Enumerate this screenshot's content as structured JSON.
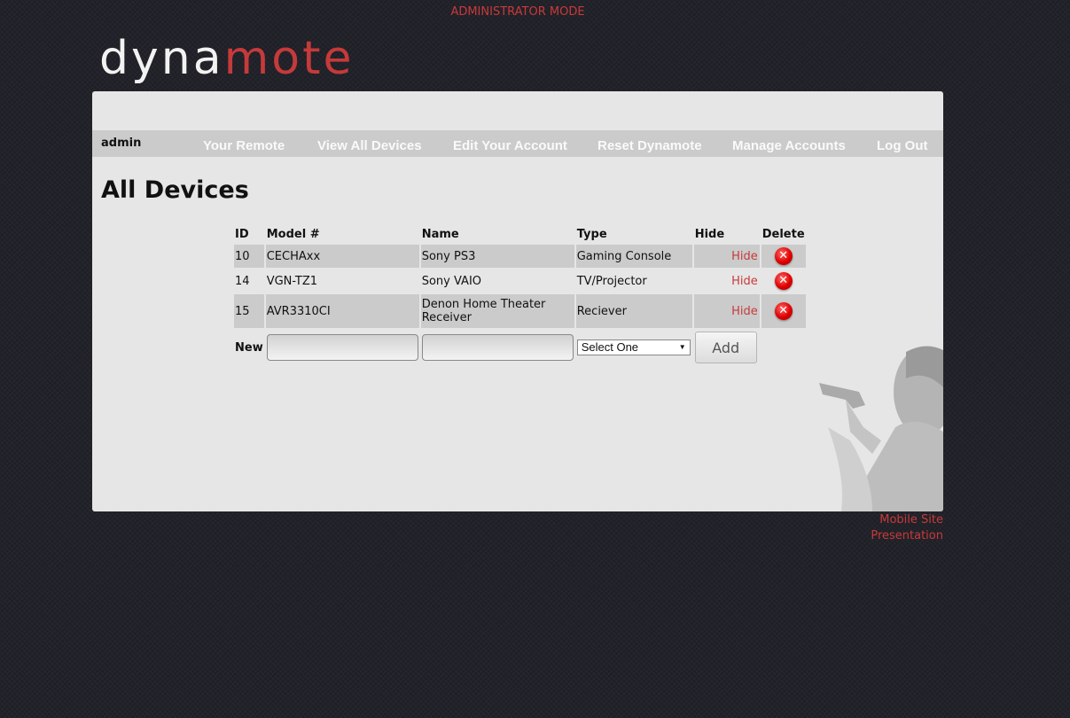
{
  "admin_mode": "ADMINISTRATOR MODE",
  "logo": {
    "part1": "dyna",
    "part2": "mote"
  },
  "nav": {
    "user": "admin",
    "items": [
      {
        "label": "Your Remote"
      },
      {
        "label": "View All Devices"
      },
      {
        "label": "Edit Your Account"
      },
      {
        "label": "Reset Dynamote"
      },
      {
        "label": "Manage Accounts"
      },
      {
        "label": "Log Out"
      }
    ]
  },
  "page_title": "All Devices",
  "table": {
    "headers": {
      "id": "ID",
      "model": "Model #",
      "name": "Name",
      "type": "Type",
      "hide": "Hide",
      "delete": "Delete"
    },
    "rows": [
      {
        "id": "10",
        "model": "CECHAxx",
        "name": "Sony PS3",
        "type": "Gaming Console",
        "hide": "Hide"
      },
      {
        "id": "14",
        "model": "VGN-TZ1",
        "name": "Sony VAIO",
        "type": "TV/Projector",
        "hide": "Hide"
      },
      {
        "id": "15",
        "model": "AVR3310CI",
        "name": "Denon Home Theater Receiver",
        "type": "Reciever",
        "hide": "Hide"
      }
    ],
    "new_row": {
      "label": "New",
      "model_value": "",
      "name_value": "",
      "type_selected": "Select One",
      "add_label": "Add"
    }
  },
  "footer": {
    "mobile_site": "Mobile Site",
    "presentation": "Presentation"
  },
  "colors": {
    "accent": "#c83a3a",
    "background": "#22222a",
    "panel": "#e6e6e6",
    "navbar": "#cbcbcb"
  }
}
